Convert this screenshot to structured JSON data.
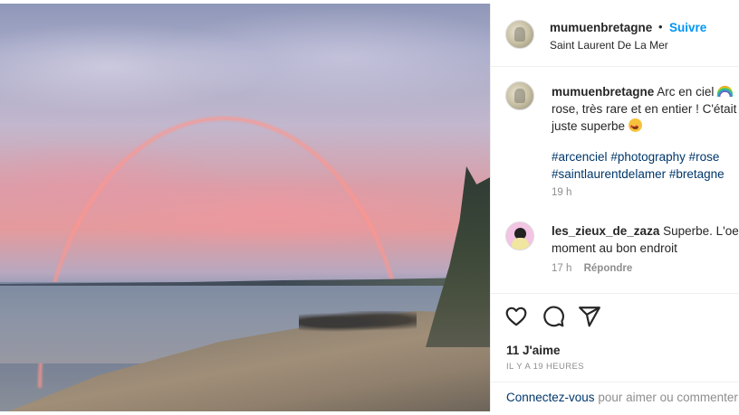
{
  "post": {
    "image_alt": "Rainbow over beach",
    "header": {
      "username": "mumuenbretagne",
      "separator": "•",
      "follow_label": "Suivre",
      "location": "Saint Laurent De La Mer"
    },
    "caption": {
      "username": "mumuenbretagne",
      "text_line1": "Arc en ciel",
      "text_line2": "rose, très rare et en entier ! C'était",
      "text_line3": "juste superbe",
      "emoji_rainbow": "rainbow-emoji",
      "emoji_starstruck": "star-struck-emoji",
      "hashtags": [
        "#arcenciel",
        "#photography",
        "#rose",
        "#saintlaurentdelamer",
        "#bretagne"
      ],
      "time": "19 h"
    },
    "comments": [
      {
        "username": "les_zieux_de_zaza",
        "text_line1": "Superbe. L'oeil",
        "text_line2": "moment au bon endroit",
        "time": "17 h",
        "reply_label": "Répondre"
      }
    ],
    "actions": {
      "like_icon": "heart-icon",
      "comment_icon": "comment-bubble-icon",
      "share_icon": "paper-plane-icon"
    },
    "likes_label": "11 J'aime",
    "posted_ago": "IL Y A 19 HEURES",
    "footer": {
      "login_link": "Connectez-vous",
      "login_text": " pour aimer ou commenter"
    }
  },
  "colors": {
    "accent": "#0095f6",
    "link": "#00376b",
    "muted": "#8e8e8e",
    "text": "#262626"
  }
}
